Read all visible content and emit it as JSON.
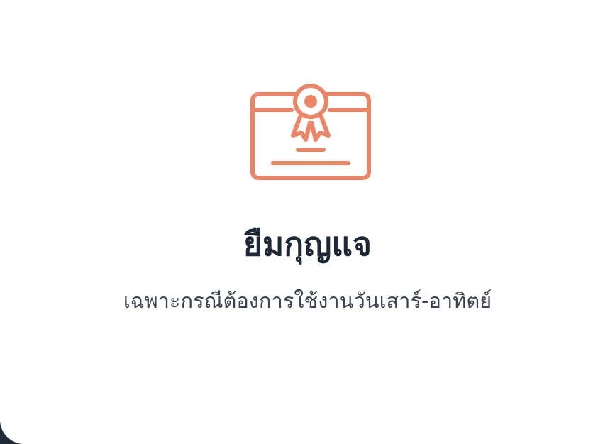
{
  "card": {
    "icon": "certificate-icon",
    "title": "ยืมกุญแจ",
    "subtitle": "เฉพาะกรณีต้องการใช้งานวันเสาร์-อาทิตย์"
  },
  "colors": {
    "accent": "#ec8466",
    "title": "#1e2937",
    "subtitle": "#3c4350",
    "background": "#ffffff",
    "backdrop": "#1f2a37"
  }
}
